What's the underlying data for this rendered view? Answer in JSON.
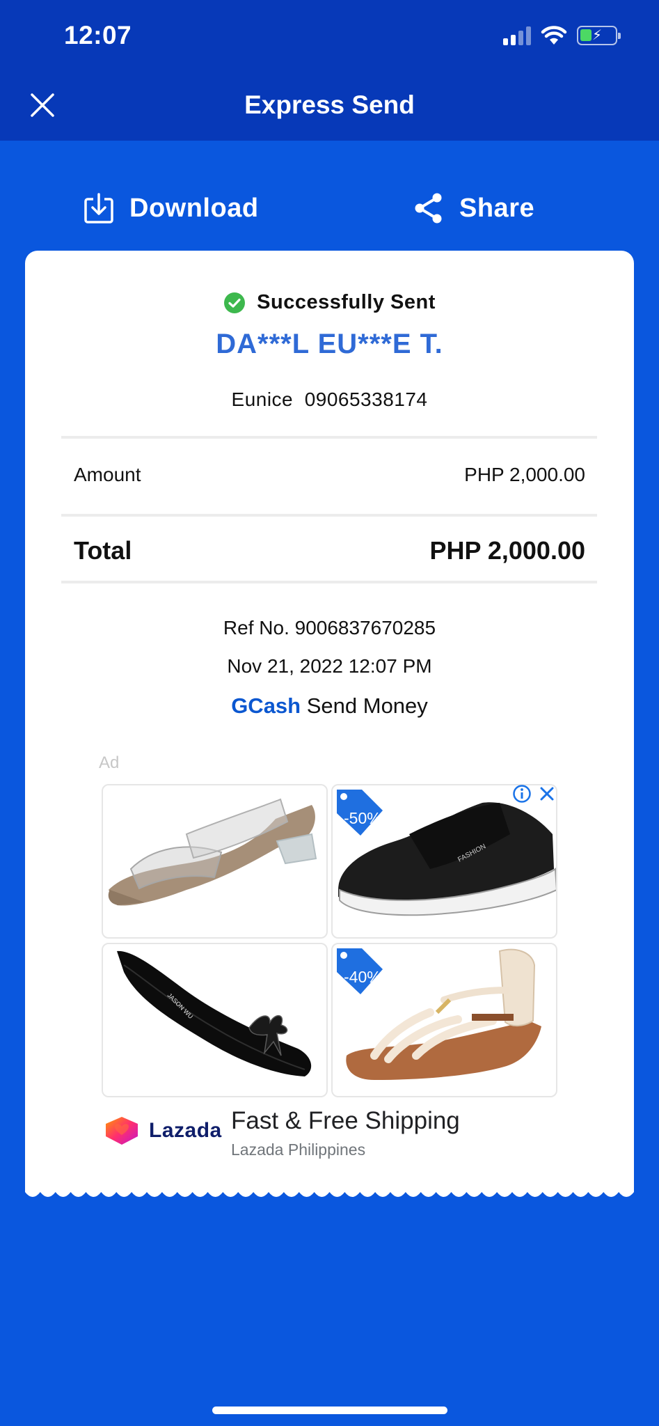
{
  "status_bar": {
    "time": "12:07",
    "icons": [
      "signal-icon",
      "wifi-icon",
      "battery-charging-icon"
    ]
  },
  "nav": {
    "title": "Express Send",
    "close_icon": "close-icon"
  },
  "actions": {
    "download_label": "Download",
    "share_label": "Share"
  },
  "receipt": {
    "status": "Successfully Sent",
    "recipient_name": "DA***L EU***E T.",
    "recipient_detail": "Eunice  09065338174",
    "amount_label": "Amount",
    "amount_value": "PHP 2,000.00",
    "total_label": "Total",
    "total_value": "PHP 2,000.00",
    "ref_no": "Ref No. 9006837670285",
    "datetime": "Nov 21, 2022 12:07 PM",
    "brand": "GCash",
    "service": "Send Money"
  },
  "ad": {
    "label": "Ad",
    "tiles": [
      {
        "name": "clear-heel-sandal",
        "badge": ""
      },
      {
        "name": "black-mesh-sneaker",
        "badge": "-50%"
      },
      {
        "name": "black-pointed-flat",
        "badge": ""
      },
      {
        "name": "braided-sandal",
        "badge": "-40%"
      }
    ],
    "advertiser_logo_text": "Lazada",
    "headline": "Fast & Free Shipping",
    "advertiser": "Lazada Philippines"
  },
  "colors": {
    "background": "#0a57de",
    "topbar": "#0739b8",
    "recipient": "#2f6ad6",
    "gcash_brand": "#0b57d0",
    "success": "#3db84d"
  }
}
